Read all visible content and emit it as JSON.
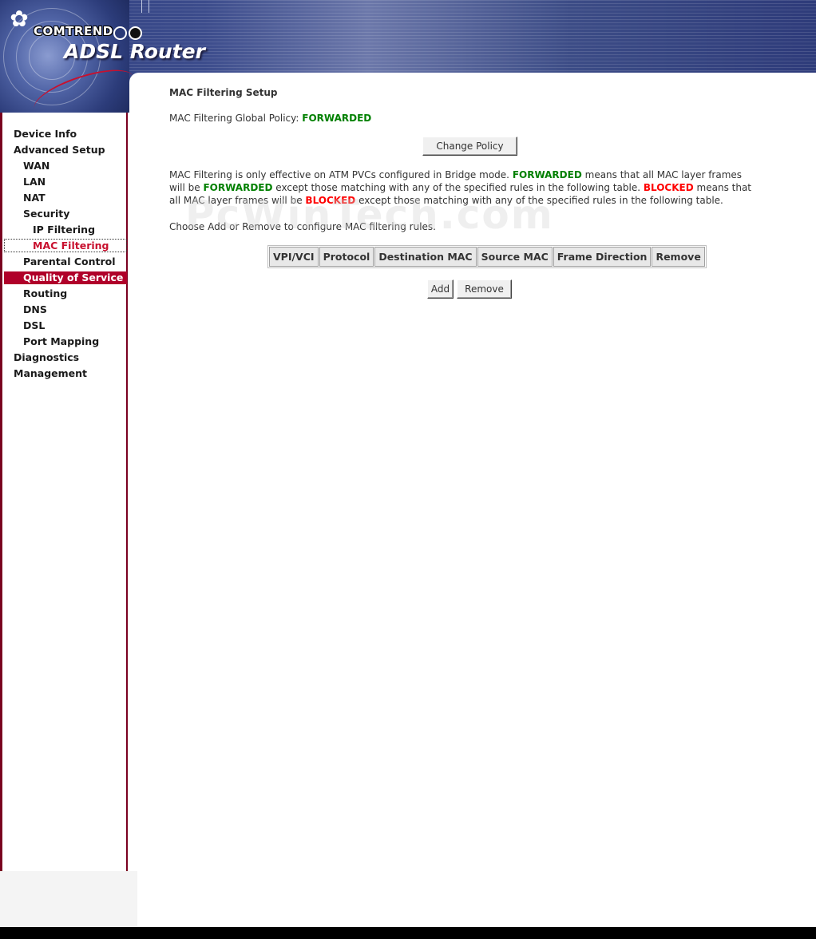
{
  "header": {
    "brand": "COMTREND",
    "product": "ADSL Router",
    "logo_icon": "comtrend-flower-icon"
  },
  "sidebar": {
    "items": [
      {
        "label": "Device Info",
        "level": 1
      },
      {
        "label": "Advanced Setup",
        "level": 1
      },
      {
        "label": "WAN",
        "level": 2
      },
      {
        "label": "LAN",
        "level": 2
      },
      {
        "label": "NAT",
        "level": 2
      },
      {
        "label": "Security",
        "level": 2
      },
      {
        "label": "IP Filtering",
        "level": 3
      },
      {
        "label": "MAC Filtering",
        "level": 3,
        "state": "selected"
      },
      {
        "label": "Parental Control",
        "level": 2
      },
      {
        "label": "Quality of Service",
        "level": 2,
        "state": "highlighted"
      },
      {
        "label": "Routing",
        "level": 2
      },
      {
        "label": "DNS",
        "level": 2
      },
      {
        "label": "DSL",
        "level": 2
      },
      {
        "label": "Port Mapping",
        "level": 2
      },
      {
        "label": "Diagnostics",
        "level": 1
      },
      {
        "label": "Management",
        "level": 1
      }
    ]
  },
  "main": {
    "title": "MAC Filtering Setup",
    "policy_label": "MAC Filtering Global Policy:",
    "policy_value": "FORWARDED",
    "change_policy_button": "Change Policy",
    "desc": {
      "p1": "MAC Filtering is only effective on ATM PVCs configured in Bridge mode.",
      "forwarded1": "FORWARDED",
      "p2": "means that all MAC layer frames will be",
      "forwarded2": "FORWARDED",
      "p3": "except those matching with any of the specified rules in the following table.",
      "blocked1": "BLOCKED",
      "p4": "means that all MAC layer frames will be",
      "blocked2": "BLOCKED",
      "p5": "except those matching with any of the specified rules in the following table."
    },
    "choose_text": "Choose Add or Remove to configure MAC filtering rules.",
    "table_headers": [
      "VPI/VCI",
      "Protocol",
      "Destination MAC",
      "Source MAC",
      "Frame Direction",
      "Remove"
    ],
    "add_button": "Add",
    "remove_button": "Remove",
    "watermark": "PcWinTech.com"
  },
  "colors": {
    "forwarded": "#008000",
    "blocked": "#ff0000",
    "nav_selected": "#c8102e",
    "nav_highlight_bg": "#b0002a",
    "banner": "#3c4c8c"
  }
}
